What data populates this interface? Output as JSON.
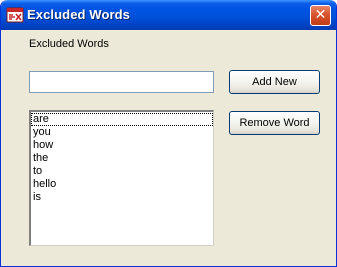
{
  "window": {
    "title": "Excluded Words",
    "close_glyph": "✕"
  },
  "form": {
    "label": "Excluded Words",
    "input_value": "",
    "add_button_label": "Add New",
    "remove_button_label": "Remove Word"
  },
  "list": {
    "items": [
      "are",
      "you",
      "how",
      "the",
      "to",
      "hello",
      "is"
    ],
    "focused_index": 0
  },
  "colors": {
    "titlebar": "#0054e3",
    "dialog_bg": "#ece9d8",
    "close_button": "#d8532f"
  },
  "icons": {
    "title_icon": "app-icon",
    "close_icon": "close-icon"
  }
}
